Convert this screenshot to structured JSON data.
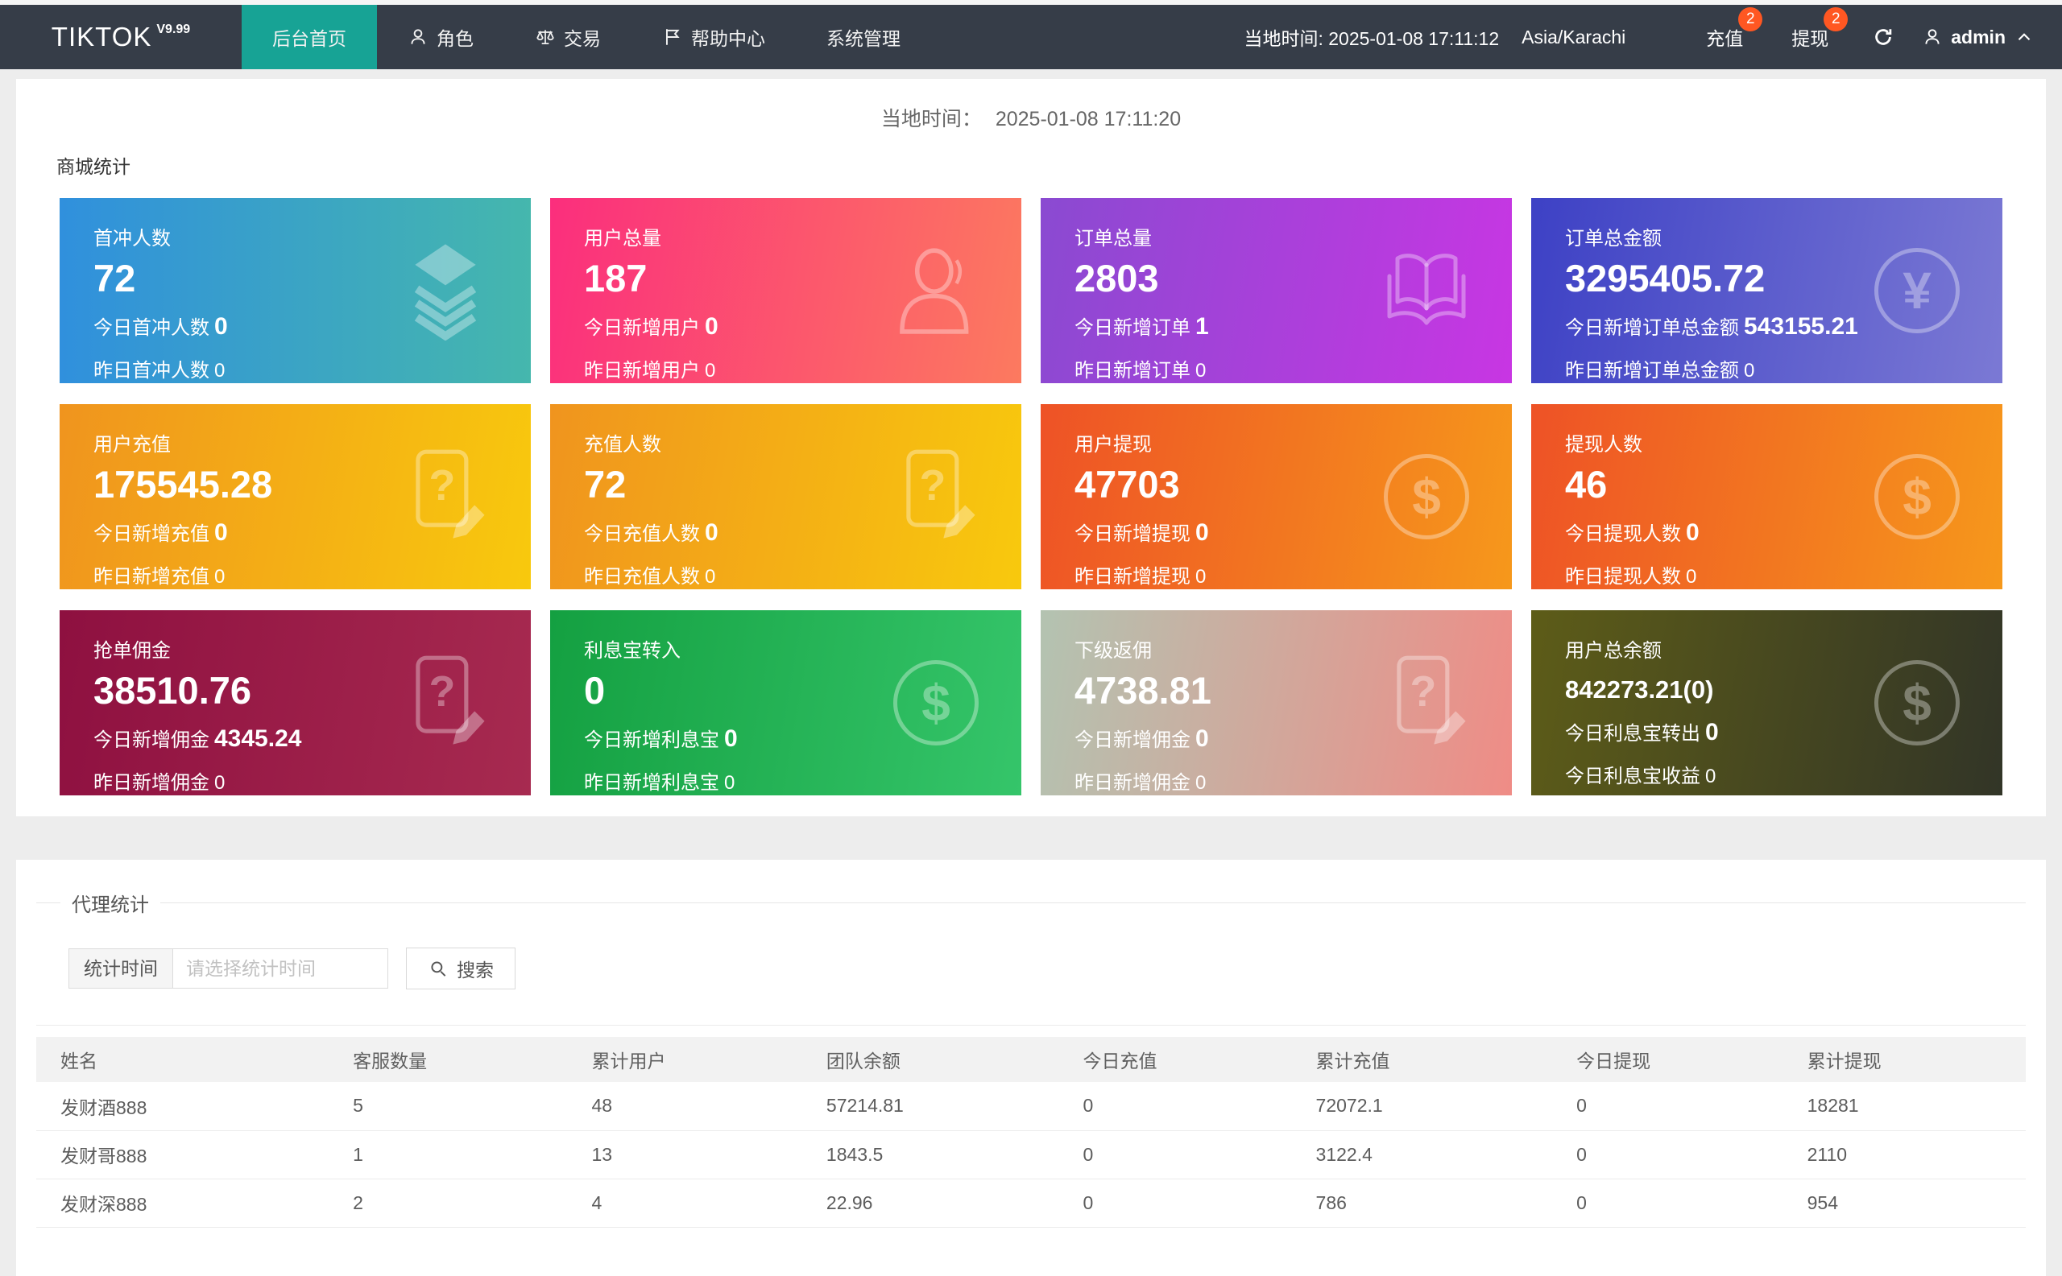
{
  "navbar": {
    "brand": "TIKTOK",
    "version": "V9.99",
    "items": [
      {
        "label": "后台首页"
      },
      {
        "label": "角色"
      },
      {
        "label": "交易"
      },
      {
        "label": "帮助中心"
      },
      {
        "label": "系统管理"
      }
    ],
    "local_time": "当地时间: 2025-01-08 17:11:12",
    "timezone": "Asia/Karachi",
    "recharge": {
      "label": "充值",
      "badge": "2"
    },
    "withdraw": {
      "label": "提现",
      "badge": "2"
    },
    "user": "admin",
    "accent_color": "#17a395",
    "badge_color": "#ff5722"
  },
  "overview": {
    "time_label": "当地时间：",
    "time_value": "2025-01-08 17:11:20",
    "section_title": "商城统计",
    "cards": [
      {
        "title": "首冲人数",
        "value": "72",
        "l2": "今日首冲人数",
        "v2": "0",
        "l3": "昨日首冲人数",
        "v3": "0",
        "icon": "layers-icon",
        "dir": "90deg",
        "g1": "#3090dd",
        "g2": "#45b7ad"
      },
      {
        "title": "用户总量",
        "value": "187",
        "l2": "今日新增用户",
        "v2": "0",
        "l3": "昨日新增用户",
        "v3": "0",
        "icon": "user-icon",
        "dir": "100deg",
        "g1": "#fb2e7d",
        "g2": "#fc7a5f"
      },
      {
        "title": "订单总量",
        "value": "2803",
        "l2": "今日新增订单",
        "v2": "1",
        "l3": "昨日新增订单",
        "v3": "0",
        "icon": "open-book-icon",
        "dir": "100deg",
        "g1": "#8a4ad1",
        "g2": "#c836e3"
      },
      {
        "title": "订单总金额",
        "value": "3295405.72",
        "l2": "今日新增订单总金额",
        "v2": "543155.21",
        "l3": "昨日新增订单总金额",
        "v3": "0",
        "icon": "yen-circle-icon",
        "dir": "100deg",
        "g1": "#3d41c5",
        "g2": "#7b79d4"
      },
      {
        "title": "用户充值",
        "value": "175545.28",
        "l2": "今日新增充值",
        "v2": "0",
        "l3": "昨日新增充值",
        "v3": "0",
        "icon": "doc-question-icon",
        "dir": "100deg",
        "g1": "#f0941e",
        "g2": "#f8c90d"
      },
      {
        "title": "充值人数",
        "value": "72",
        "l2": "今日充值人数",
        "v2": "0",
        "l3": "昨日充值人数",
        "v3": "0",
        "icon": "doc-question-icon",
        "dir": "100deg",
        "g1": "#f0941e",
        "g2": "#f8c90d"
      },
      {
        "title": "用户提现",
        "value": "47703",
        "l2": "今日新增提现",
        "v2": "0",
        "l3": "昨日新增提现",
        "v3": "0",
        "icon": "dollar-circle-icon",
        "dir": "100deg",
        "g1": "#ee5226",
        "g2": "#f6981b"
      },
      {
        "title": "提现人数",
        "value": "46",
        "l2": "今日提现人数",
        "v2": "0",
        "l3": "昨日提现人数",
        "v3": "0",
        "icon": "dollar-circle-icon",
        "dir": "100deg",
        "g1": "#ee5226",
        "g2": "#f6981b"
      },
      {
        "title": "抢单佣金",
        "value": "38510.76",
        "l2": "今日新增佣金",
        "v2": "4345.24",
        "l3": "昨日新增佣金",
        "v3": "0",
        "icon": "doc-question-icon",
        "dir": "100deg",
        "g1": "#8e1040",
        "g2": "#a72a50"
      },
      {
        "title": "利息宝转入",
        "value": "0",
        "l2": "今日新增利息宝",
        "v2": "0",
        "l3": "昨日新增利息宝",
        "v3": "0",
        "icon": "dollar-circle-icon",
        "dir": "100deg",
        "g1": "#14a041",
        "g2": "#35c56a"
      },
      {
        "title": "下级返佣",
        "value": "4738.81",
        "l2": "今日新增佣金",
        "v2": "0",
        "l3": "昨日新增佣金",
        "v3": "0",
        "icon": "doc-question-icon",
        "dir": "100deg",
        "g1": "#b3c3b1",
        "g2": "#ef8c86"
      },
      {
        "title": "用户总余额",
        "value": "842273.21(0)",
        "l2": "今日利息宝转出",
        "v2": "0",
        "l3": "今日利息宝收益",
        "v3": "0",
        "icon": "dollar-circle-icon",
        "dir": "100deg",
        "g1": "#5d5c18",
        "g2": "#323527"
      }
    ]
  },
  "agent": {
    "legend": "代理统计",
    "filter_label": "统计时间",
    "filter_placeholder": "请选择统计时间",
    "filter_value": "",
    "search_label": "搜索",
    "table": {
      "headers": [
        "姓名",
        "客服数量",
        "累计用户",
        "团队余额",
        "今日充值",
        "累计充值",
        "今日提现",
        "累计提现"
      ],
      "rows": [
        [
          "发财酒888",
          "5",
          "48",
          "57214.81",
          "0",
          "72072.1",
          "0",
          "18281"
        ],
        [
          "发财哥888",
          "1",
          "13",
          "1843.5",
          "0",
          "3122.4",
          "0",
          "2110"
        ],
        [
          "发财深888",
          "2",
          "4",
          "22.96",
          "0",
          "786",
          "0",
          "954"
        ]
      ]
    }
  }
}
